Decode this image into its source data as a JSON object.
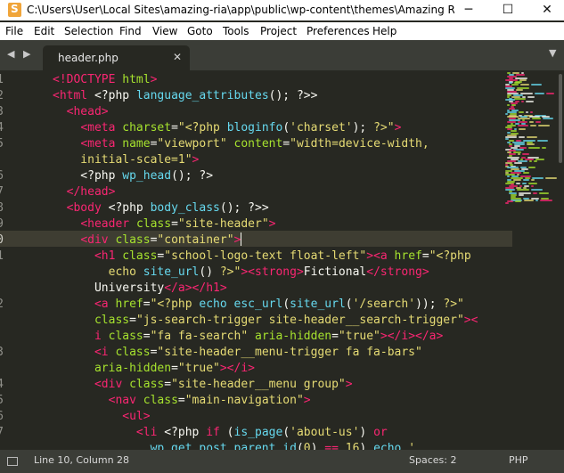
{
  "window": {
    "title": "C:\\Users\\User\\Local Sites\\amazing-ria\\app\\public\\wp-content\\themes\\Amazing Ria\\he...",
    "minimize": "─",
    "maximize": "☐",
    "close": "✕"
  },
  "menu": [
    "File",
    "Edit",
    "Selection",
    "Find",
    "View",
    "Goto",
    "Tools",
    "Project",
    "Preferences",
    "Help"
  ],
  "tabs": {
    "nav": "◀ ▶",
    "active_label": "header.php",
    "close": "✕",
    "dropdown": "▼"
  },
  "lines": [
    {
      "n": "1",
      "tokens": [
        [
          "t",
          "<!DOCTYPE"
        ],
        [
          "p",
          " "
        ],
        [
          "a",
          "html"
        ],
        [
          "t",
          ">"
        ]
      ]
    },
    {
      "n": "2",
      "tokens": [
        [
          "t",
          "<html"
        ],
        [
          "p",
          " <?php "
        ],
        [
          "f",
          "language_attributes"
        ],
        [
          "p",
          "(); ?>>"
        ]
      ]
    },
    {
      "n": "3",
      "tokens": [
        [
          "p",
          "  "
        ],
        [
          "t",
          "<head>"
        ]
      ]
    },
    {
      "n": "4",
      "tokens": [
        [
          "p",
          "    "
        ],
        [
          "t",
          "<meta"
        ],
        [
          "p",
          " "
        ],
        [
          "a",
          "charset"
        ],
        [
          "p",
          "="
        ],
        [
          "s",
          "\"<?php "
        ],
        [
          "f",
          "bloginfo"
        ],
        [
          "p",
          "("
        ],
        [
          "s",
          "'charset'"
        ],
        [
          "p",
          "); "
        ],
        [
          "s",
          "?>\""
        ],
        [
          "t",
          ">"
        ]
      ]
    },
    {
      "n": "5",
      "tokens": [
        [
          "p",
          "    "
        ],
        [
          "t",
          "<meta"
        ],
        [
          "p",
          " "
        ],
        [
          "a",
          "name"
        ],
        [
          "p",
          "="
        ],
        [
          "s",
          "\"viewport\""
        ],
        [
          "p",
          " "
        ],
        [
          "a",
          "content"
        ],
        [
          "p",
          "="
        ],
        [
          "s",
          "\"width=device-width,"
        ]
      ]
    },
    {
      "n": "",
      "tokens": [
        [
          "s",
          "    initial-scale=1\""
        ],
        [
          "t",
          ">"
        ]
      ]
    },
    {
      "n": "6",
      "tokens": [
        [
          "p",
          "    <?php "
        ],
        [
          "f",
          "wp_head"
        ],
        [
          "p",
          "(); ?>"
        ]
      ]
    },
    {
      "n": "7",
      "tokens": [
        [
          "p",
          "  "
        ],
        [
          "t",
          "</head>"
        ]
      ]
    },
    {
      "n": "8",
      "tokens": [
        [
          "p",
          "  "
        ],
        [
          "t",
          "<body"
        ],
        [
          "p",
          " <?php "
        ],
        [
          "f",
          "body_class"
        ],
        [
          "p",
          "(); ?>>"
        ]
      ]
    },
    {
      "n": "9",
      "tokens": [
        [
          "p",
          "    "
        ],
        [
          "t",
          "<header"
        ],
        [
          "p",
          " "
        ],
        [
          "a",
          "class"
        ],
        [
          "p",
          "="
        ],
        [
          "s",
          "\"site-header\""
        ],
        [
          "t",
          ">"
        ]
      ]
    },
    {
      "n": "10",
      "current": true,
      "tokens": [
        [
          "p",
          "    "
        ],
        [
          "t",
          "<div"
        ],
        [
          "p",
          " "
        ],
        [
          "a",
          "class"
        ],
        [
          "p",
          "="
        ],
        [
          "s",
          "\"container\""
        ],
        [
          "t",
          ">"
        ]
      ]
    },
    {
      "n": "11",
      "tokens": [
        [
          "p",
          "      "
        ],
        [
          "t",
          "<h1"
        ],
        [
          "p",
          " "
        ],
        [
          "a",
          "class"
        ],
        [
          "p",
          "="
        ],
        [
          "s",
          "\"school-logo-text float-left\""
        ],
        [
          "t",
          ">"
        ],
        [
          "t",
          "<a"
        ],
        [
          "p",
          " "
        ],
        [
          "a",
          "href"
        ],
        [
          "p",
          "="
        ],
        [
          "s",
          "\"<?php"
        ]
      ]
    },
    {
      "n": "",
      "tokens": [
        [
          "s",
          "        echo "
        ],
        [
          "f",
          "site_url"
        ],
        [
          "p",
          "() "
        ],
        [
          "s",
          "?>\""
        ],
        [
          "t",
          ">"
        ],
        [
          "t",
          "<strong>"
        ],
        [
          "p",
          "Fictional"
        ],
        [
          "t",
          "</strong>"
        ]
      ]
    },
    {
      "n": "",
      "tokens": [
        [
          "p",
          "      University"
        ],
        [
          "t",
          "</a></h1>"
        ]
      ]
    },
    {
      "n": "12",
      "tokens": [
        [
          "p",
          "      "
        ],
        [
          "t",
          "<a"
        ],
        [
          "p",
          " "
        ],
        [
          "a",
          "href"
        ],
        [
          "p",
          "="
        ],
        [
          "s",
          "\"<?php "
        ],
        [
          "f",
          "echo"
        ],
        [
          "p",
          " "
        ],
        [
          "f",
          "esc_url"
        ],
        [
          "p",
          "("
        ],
        [
          "f",
          "site_url"
        ],
        [
          "p",
          "("
        ],
        [
          "s",
          "'/search'"
        ],
        [
          "p",
          ")); "
        ],
        [
          "s",
          "?>\""
        ]
      ]
    },
    {
      "n": "",
      "tokens": [
        [
          "p",
          "      "
        ],
        [
          "a",
          "class"
        ],
        [
          "p",
          "="
        ],
        [
          "s",
          "\"js-search-trigger site-header__search-trigger\""
        ],
        [
          "t",
          ">"
        ],
        [
          "t",
          "<"
        ]
      ]
    },
    {
      "n": "",
      "tokens": [
        [
          "t",
          "      i"
        ],
        [
          "p",
          " "
        ],
        [
          "a",
          "class"
        ],
        [
          "p",
          "="
        ],
        [
          "s",
          "\"fa fa-search\""
        ],
        [
          "p",
          " "
        ],
        [
          "a",
          "aria-hidden"
        ],
        [
          "p",
          "="
        ],
        [
          "s",
          "\"true\""
        ],
        [
          "t",
          "></i></a>"
        ]
      ]
    },
    {
      "n": "13",
      "tokens": [
        [
          "p",
          "      "
        ],
        [
          "t",
          "<i"
        ],
        [
          "p",
          " "
        ],
        [
          "a",
          "class"
        ],
        [
          "p",
          "="
        ],
        [
          "s",
          "\"site-header__menu-trigger fa fa-bars\""
        ]
      ]
    },
    {
      "n": "",
      "tokens": [
        [
          "p",
          "      "
        ],
        [
          "a",
          "aria-hidden"
        ],
        [
          "p",
          "="
        ],
        [
          "s",
          "\"true\""
        ],
        [
          "t",
          "></i>"
        ]
      ]
    },
    {
      "n": "14",
      "tokens": [
        [
          "p",
          "      "
        ],
        [
          "t",
          "<div"
        ],
        [
          "p",
          " "
        ],
        [
          "a",
          "class"
        ],
        [
          "p",
          "="
        ],
        [
          "s",
          "\"site-header__menu group\""
        ],
        [
          "t",
          ">"
        ]
      ]
    },
    {
      "n": "15",
      "tokens": [
        [
          "p",
          "        "
        ],
        [
          "t",
          "<nav"
        ],
        [
          "p",
          " "
        ],
        [
          "a",
          "class"
        ],
        [
          "p",
          "="
        ],
        [
          "s",
          "\"main-navigation\""
        ],
        [
          "t",
          ">"
        ]
      ]
    },
    {
      "n": "16",
      "tokens": [
        [
          "p",
          "          "
        ],
        [
          "t",
          "<ul>"
        ]
      ]
    },
    {
      "n": "17",
      "tokens": [
        [
          "p",
          "            "
        ],
        [
          "t",
          "<li"
        ],
        [
          "p",
          " <?php "
        ],
        [
          "t",
          "if"
        ],
        [
          "p",
          " ("
        ],
        [
          "f",
          "is_page"
        ],
        [
          "p",
          "("
        ],
        [
          "s",
          "'about-us'"
        ],
        [
          "p",
          ") "
        ],
        [
          "t",
          "or"
        ]
      ]
    },
    {
      "n": "",
      "tokens": [
        [
          "p",
          "              "
        ],
        [
          "f",
          "wp_get_post_parent_id"
        ],
        [
          "p",
          "("
        ],
        [
          "s",
          "0"
        ],
        [
          "p",
          ") "
        ],
        [
          "t",
          "=="
        ],
        [
          "p",
          " "
        ],
        [
          "s",
          "16"
        ],
        [
          "p",
          ") "
        ],
        [
          "f",
          "echo"
        ],
        [
          "p",
          " "
        ],
        [
          "s",
          "'"
        ]
      ]
    }
  ],
  "status": {
    "position": "Line 10, Column 28",
    "spaces": "Spaces: 2",
    "syntax": "PHP"
  },
  "colors": {
    "background": "#272822",
    "tag": "#f92672",
    "attribute": "#a6e22e",
    "string": "#e6db74",
    "function": "#66d9ef",
    "text": "#f8f8f2"
  }
}
